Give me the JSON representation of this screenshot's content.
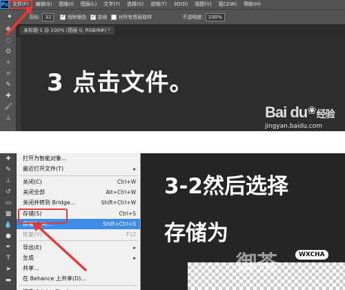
{
  "top": {
    "menu": [
      "Ps",
      "文件(F)",
      "编辑(E)",
      "图像(I)",
      "图层(L)",
      "文字(Y)",
      "选择(S)",
      "滤镜(T)",
      "3D(D)",
      "视图(V)",
      "窗口(W)",
      "帮助(H)"
    ],
    "options": {
      "feather_label": "羽化:",
      "feather_value": "32",
      "antialias_label": "消除锯齿",
      "contiguous_label": "连续",
      "all_layers_label": "对所有图层取样",
      "opacity_label": "不透明度:",
      "opacity_value": "100%"
    },
    "doc_tab": "未标题-1 @ 100% (图层 0, RGB/8#) *",
    "caption": "3 点击文件。",
    "watermark": {
      "logo": "Bai du",
      "suffix": "经验",
      "url": "jingyan.baidu.com"
    }
  },
  "bottom": {
    "menu_items": [
      {
        "label": "打开为智能对象...",
        "shortcut": ""
      },
      {
        "label": "最近打开文件(T)",
        "shortcut": "▸"
      },
      {
        "sep": true
      },
      {
        "label": "关闭(C)",
        "shortcut": "Ctrl+W"
      },
      {
        "label": "关闭全部",
        "shortcut": "Alt+Ctrl+W"
      },
      {
        "label": "关闭并转到 Bridge...",
        "shortcut": "Shift+Ctrl+W"
      },
      {
        "label": "存储(S)",
        "shortcut": "Ctrl+S"
      },
      {
        "label": "存储为(A)...",
        "shortcut": "Shift+Ctrl+S",
        "selected": true
      },
      {
        "label": "恢复(V)",
        "shortcut": "F12",
        "disabled": true
      },
      {
        "sep": true
      },
      {
        "label": "导出(E)",
        "shortcut": "▸"
      },
      {
        "label": "生成",
        "shortcut": "▸"
      },
      {
        "label": "共享...",
        "shortcut": ""
      },
      {
        "label": "在 Behance 上共享(D)...",
        "shortcut": ""
      },
      {
        "sep": true
      },
      {
        "label": "搜索 Adobe Stock...",
        "shortcut": ""
      }
    ],
    "caption_line1": "3-2然后选择",
    "caption_line2": "存储为",
    "watermark_text": "御茶",
    "watermark_badge": "WXCHA"
  },
  "colors": {
    "highlight": "#e53935",
    "menu_selected": "#3c8ce8"
  }
}
